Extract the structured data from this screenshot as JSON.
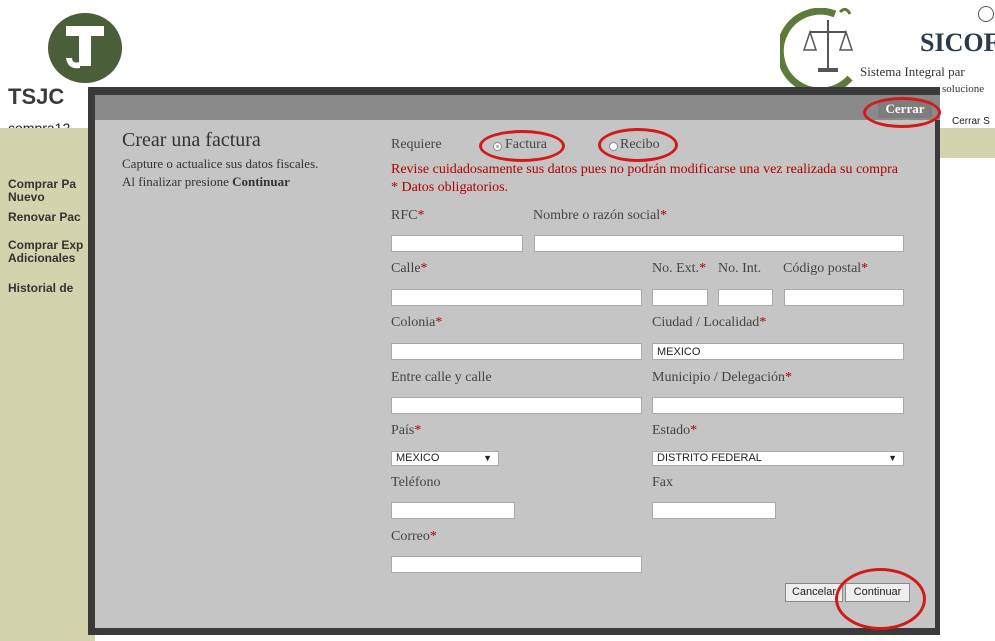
{
  "header": {
    "logo_text": "TSJC",
    "logo_suffix": "...",
    "user": "compra12",
    "brand_title": "SICOF",
    "brand_sub1": "Sistema Integral par",
    "brand_sub2": "solucione",
    "logout": "Cerrar S"
  },
  "sidebar": {
    "items": [
      {
        "label": "Comprar Pa"
      },
      {
        "label": "Nuevo"
      },
      {
        "label": "Renovar Pac"
      },
      {
        "label": "Comprar Exp"
      },
      {
        "label": "Adicionales"
      },
      {
        "label": "Historial de"
      }
    ]
  },
  "modal": {
    "close": "Cerrar",
    "title": "Crear una factura",
    "desc1": "Capture o actualice sus datos fiscales.",
    "desc2": "Al finalizar presione",
    "desc2_bold": "Continuar",
    "requiere": "Requiere",
    "option_factura": "Factura",
    "option_recibo": "Recibo",
    "warning": "Revise cuidadosamente sus datos pues no podrán modificarse una vez realizada su compra",
    "required_note": "* Datos obligatorios.",
    "fields": {
      "rfc": "RFC",
      "nombre": "Nombre o razón social",
      "calle": "Calle",
      "no_ext": "No. Ext.",
      "no_int": "No. Int.",
      "cp": "Código postal",
      "colonia": "Colonia",
      "ciudad": "Ciudad / Localidad",
      "ciudad_value": "MEXICO",
      "entre": "Entre calle y calle",
      "municipio": "Municipio / Delegación",
      "pais": "País",
      "pais_value": "MEXICO",
      "estado": "Estado",
      "estado_value": "DISTRITO FEDERAL",
      "telefono": "Teléfono",
      "fax": "Fax",
      "correo": "Correo"
    },
    "star": "*",
    "cancel": "Cancelar",
    "continue": "Continuar"
  },
  "colors": {
    "annotation": "#d21a1a",
    "accent": "#b00000"
  }
}
